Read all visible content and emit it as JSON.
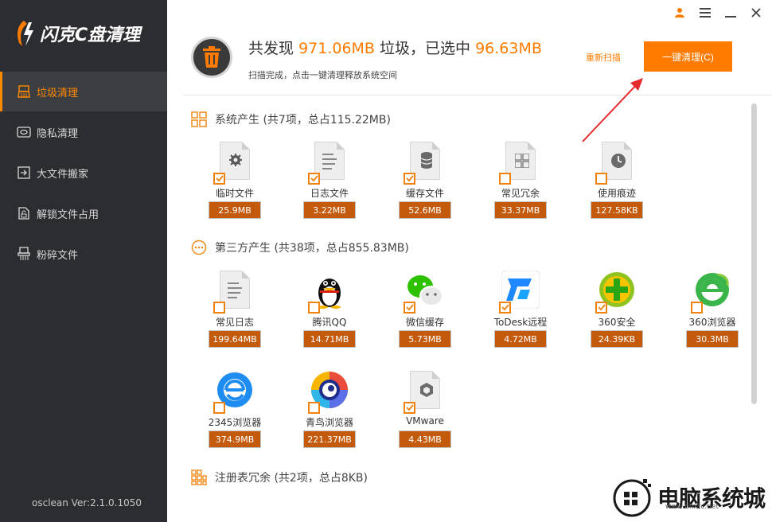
{
  "app": {
    "logo_text": "闪克C盘清理",
    "version": "osclean Ver:2.1.0.1050"
  },
  "sidebar": {
    "items": [
      {
        "label": "垃圾清理",
        "icon": "broom-icon",
        "active": true
      },
      {
        "label": "隐私清理",
        "icon": "eye-icon",
        "active": false
      },
      {
        "label": "大文件搬家",
        "icon": "move-icon",
        "active": false
      },
      {
        "label": "解锁文件占用",
        "icon": "unlock-file-icon",
        "active": false
      },
      {
        "label": "粉碎文件",
        "icon": "shredder-icon",
        "active": false
      }
    ]
  },
  "header": {
    "summary_prefix": "共发现",
    "found_size": "971.06MB",
    "summary_mid": "垃圾，已选中",
    "selected_size": "96.63MB",
    "subtitle": "扫描完成，点击一键清理释放系统空间",
    "rescan_label": "重新扫描",
    "clean_button_label": "一键清理(C)"
  },
  "sections": [
    {
      "title": "系统产生 (共7项，总占115.22MB)",
      "icon": "grid-icon",
      "items": [
        {
          "name": "临时文件",
          "size": "25.9MB",
          "icon": "gear-file-icon"
        },
        {
          "name": "日志文件",
          "size": "3.22MB",
          "icon": "log-file-icon"
        },
        {
          "name": "缓存文件",
          "size": "52.6MB",
          "icon": "database-file-icon"
        },
        {
          "name": "常见冗余",
          "size": "33.37MB",
          "icon": "windows-file-icon"
        },
        {
          "name": "使用痕迹",
          "size": "127.58KB",
          "icon": "clock-file-icon"
        }
      ]
    },
    {
      "title": "第三方产生 (共38项，总占855.83MB)",
      "icon": "ellipsis-circle-icon",
      "items": [
        {
          "name": "常见日志",
          "size": "199.64MB",
          "icon": "log-file-icon"
        },
        {
          "name": "腾讯QQ",
          "size": "14.71MB",
          "icon": "qq-icon"
        },
        {
          "name": "微信缓存",
          "size": "5.73MB",
          "icon": "wechat-icon"
        },
        {
          "name": "ToDesk远程",
          "size": "4.72MB",
          "icon": "todesk-icon"
        },
        {
          "name": "360安全",
          "size": "24.39KB",
          "icon": "360-safe-icon"
        },
        {
          "name": "360浏览器",
          "size": "30.3MB",
          "icon": "360-browser-icon"
        },
        {
          "name": "2345浏览器",
          "size": "374.9MB",
          "icon": "2345-browser-icon"
        },
        {
          "name": "青鸟浏览器",
          "size": "221.37MB",
          "icon": "qingniao-browser-icon"
        },
        {
          "name": "VMware",
          "size": "4.43MB",
          "icon": "vmware-file-icon"
        }
      ]
    },
    {
      "title": "注册表冗余 (共2项，总占8KB)",
      "icon": "registry-grid-icon",
      "items": []
    }
  ],
  "watermark": {
    "text": "电脑系统城",
    "url": "www.dnxtc.net"
  },
  "colors": {
    "accent": "#ff7b00",
    "size_badge": "#c45a0c",
    "sidebar_bg": "#2c2d30"
  }
}
